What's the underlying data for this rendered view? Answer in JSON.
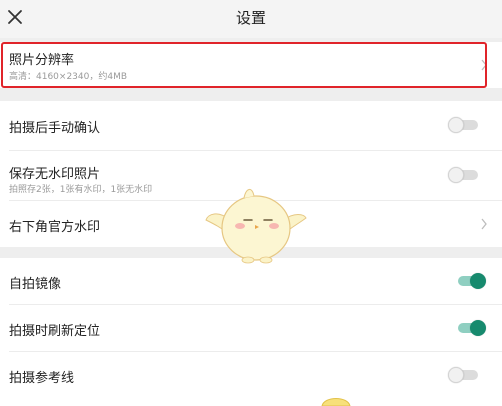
{
  "header": {
    "title": "设置",
    "close_icon": "close-icon"
  },
  "rows": [
    {
      "title": "照片分辨率",
      "subtitle": "高清：4160×2340，约4MB",
      "control": "chevron",
      "highlighted": true
    },
    {
      "title": "拍摄后手动确认",
      "control": "toggle",
      "state": "off"
    },
    {
      "title": "保存无水印照片",
      "subtitle": "拍照存2张，1张有水印，1张无水印",
      "control": "toggle",
      "state": "off"
    },
    {
      "title": "右下角官方水印",
      "control": "chevron"
    },
    {
      "title": "自拍镜像",
      "control": "toggle",
      "state": "on"
    },
    {
      "title": "拍摄时刷新定位",
      "control": "toggle",
      "state": "on"
    },
    {
      "title": "拍摄参考线",
      "control": "toggle",
      "state": "off"
    }
  ],
  "colors": {
    "accent": "#178a6e",
    "highlight_border": "#e0242a",
    "background": "#eeeeee"
  }
}
